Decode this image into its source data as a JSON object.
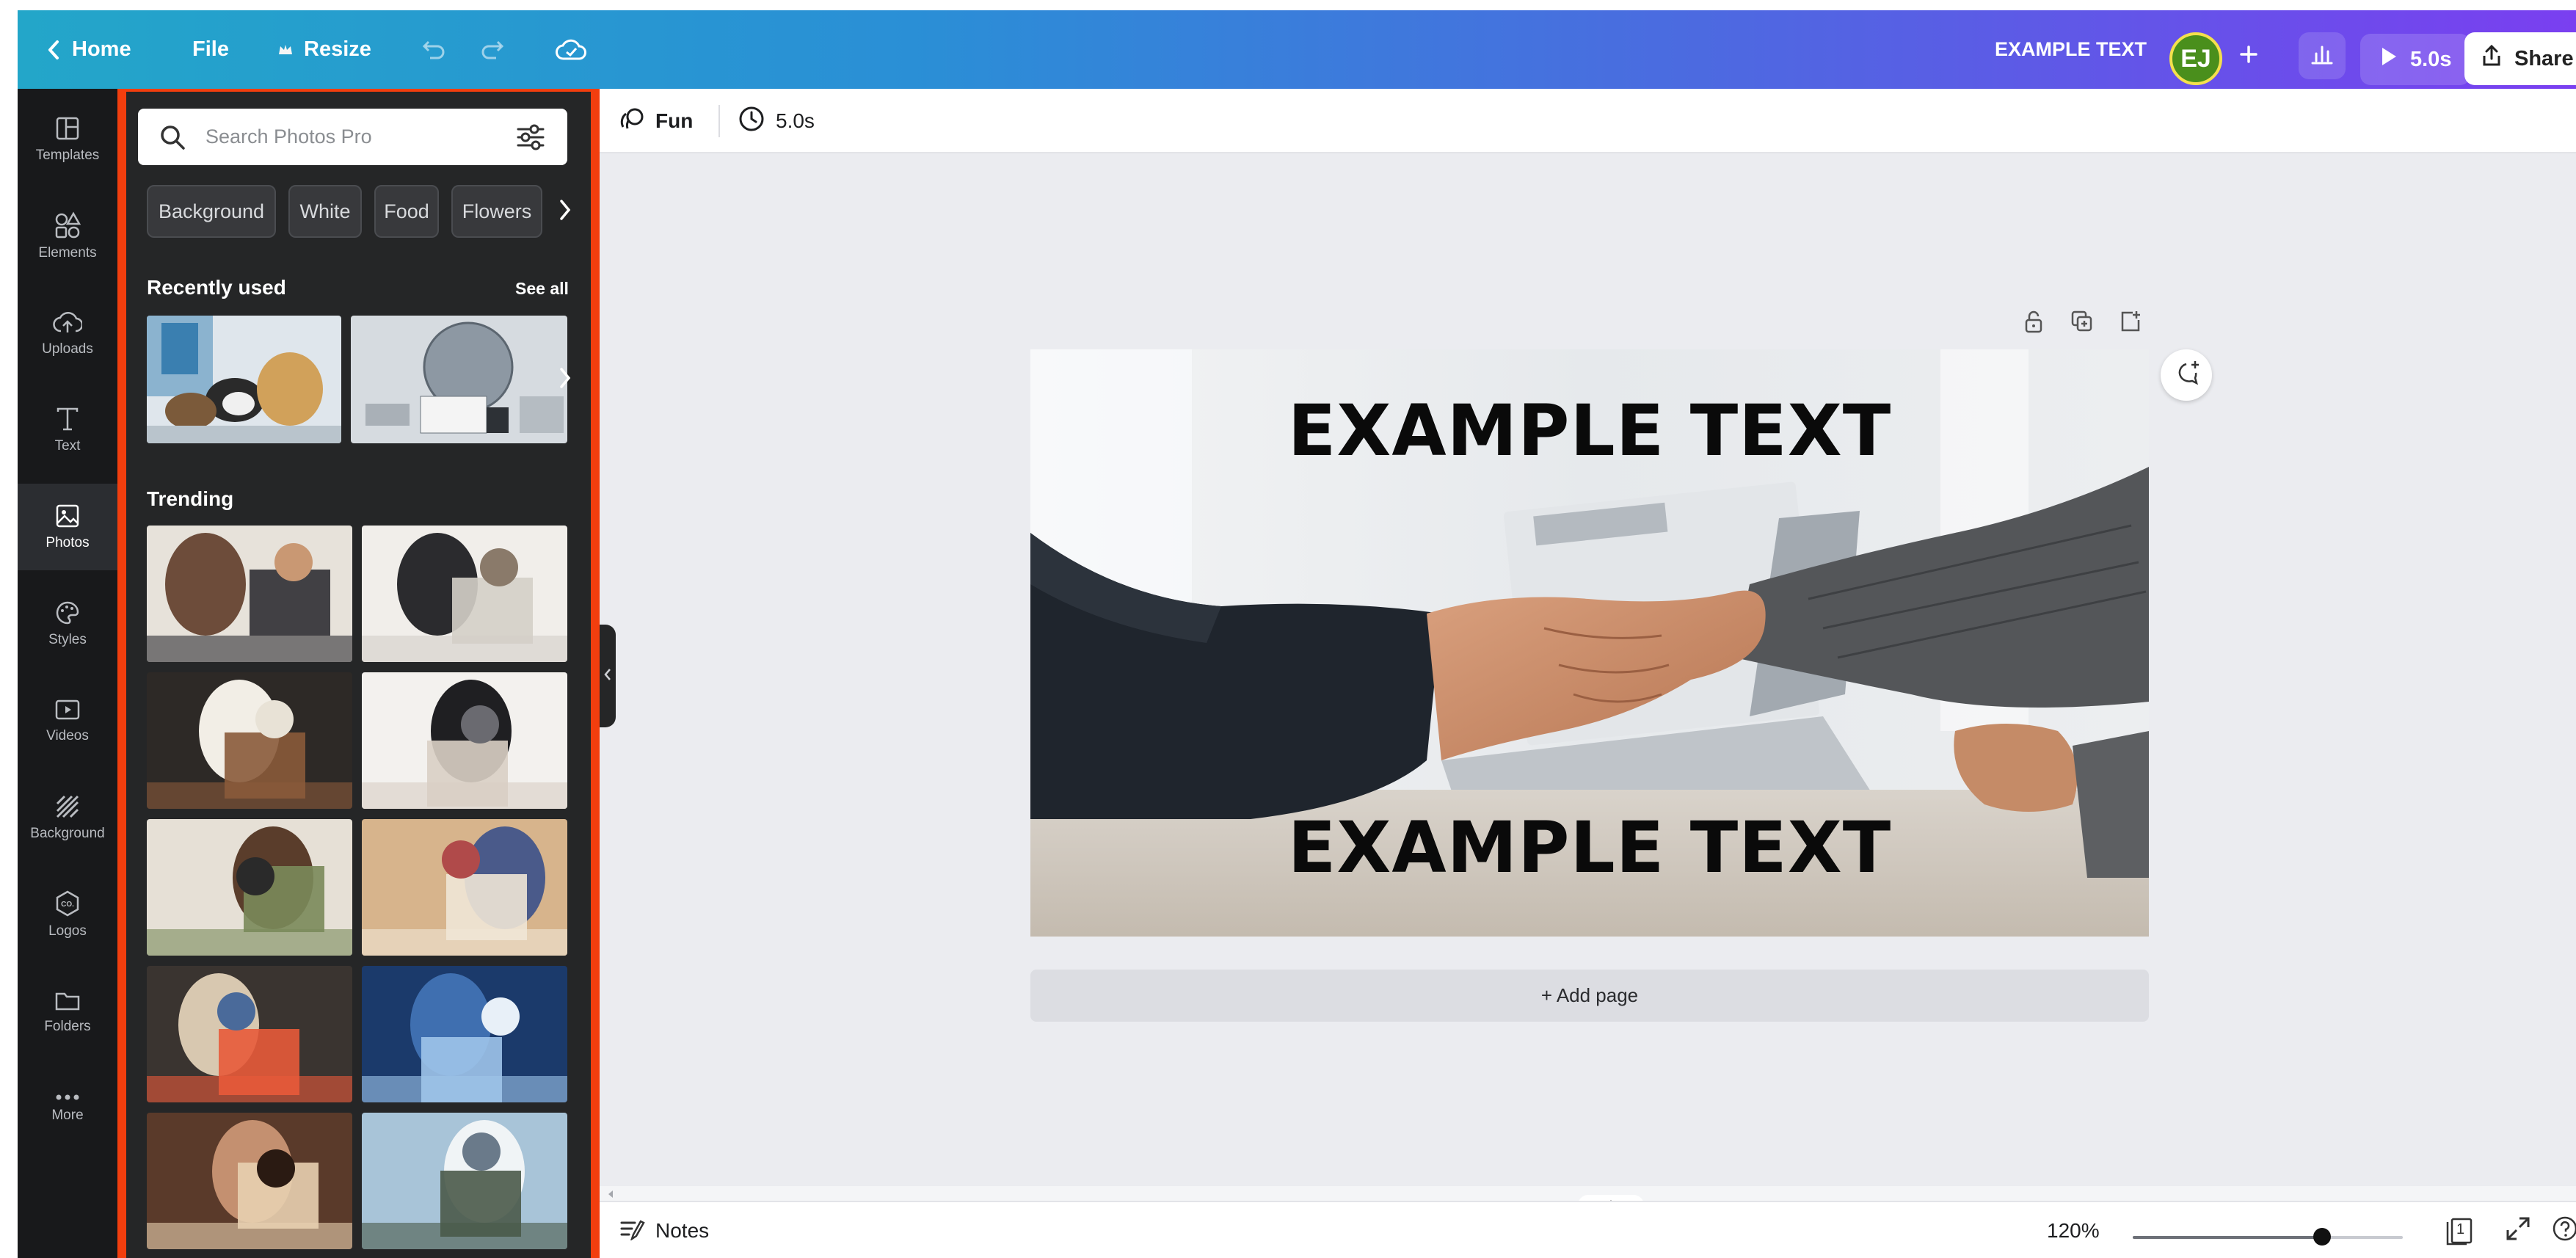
{
  "topbar": {
    "home_label": "Home",
    "file_label": "File",
    "resize_label": "Resize",
    "design_title": "EXAMPLE TEXT",
    "avatar_initials": "EJ",
    "play_duration": "5.0s",
    "share_label": "Share"
  },
  "rail": {
    "items": [
      {
        "label": "Templates",
        "icon": "templates-icon"
      },
      {
        "label": "Elements",
        "icon": "elements-icon"
      },
      {
        "label": "Uploads",
        "icon": "uploads-icon"
      },
      {
        "label": "Text",
        "icon": "text-icon"
      },
      {
        "label": "Photos",
        "icon": "photos-icon",
        "active": true
      },
      {
        "label": "Styles",
        "icon": "styles-icon"
      },
      {
        "label": "Videos",
        "icon": "videos-icon"
      },
      {
        "label": "Background",
        "icon": "background-icon"
      },
      {
        "label": "Logos",
        "icon": "logos-icon"
      },
      {
        "label": "Folders",
        "icon": "folders-icon"
      },
      {
        "label": "More",
        "icon": "more-icon"
      }
    ]
  },
  "panel": {
    "search_placeholder": "Search Photos Pro",
    "chips": [
      "Background",
      "White",
      "Food",
      "Flowers"
    ],
    "recent_title": "Recently used",
    "see_all_label": "See all",
    "trending_title": "Trending"
  },
  "context": {
    "animation_label": "Fun",
    "duration_label": "5.0s"
  },
  "canvas": {
    "text_top": "EXAMPLE TEXT",
    "text_bottom": "EXAMPLE TEXT",
    "add_page_label": "+ Add page"
  },
  "bottombar": {
    "notes_label": "Notes",
    "zoom_label": "120%",
    "zoom_level_fraction": 0.7,
    "page_count": "1"
  },
  "colors": {
    "panel_highlight": "#f23e0e",
    "rail_bg": "#18191b",
    "panel_bg": "#252627",
    "workspace_bg": "#ebecf0"
  }
}
